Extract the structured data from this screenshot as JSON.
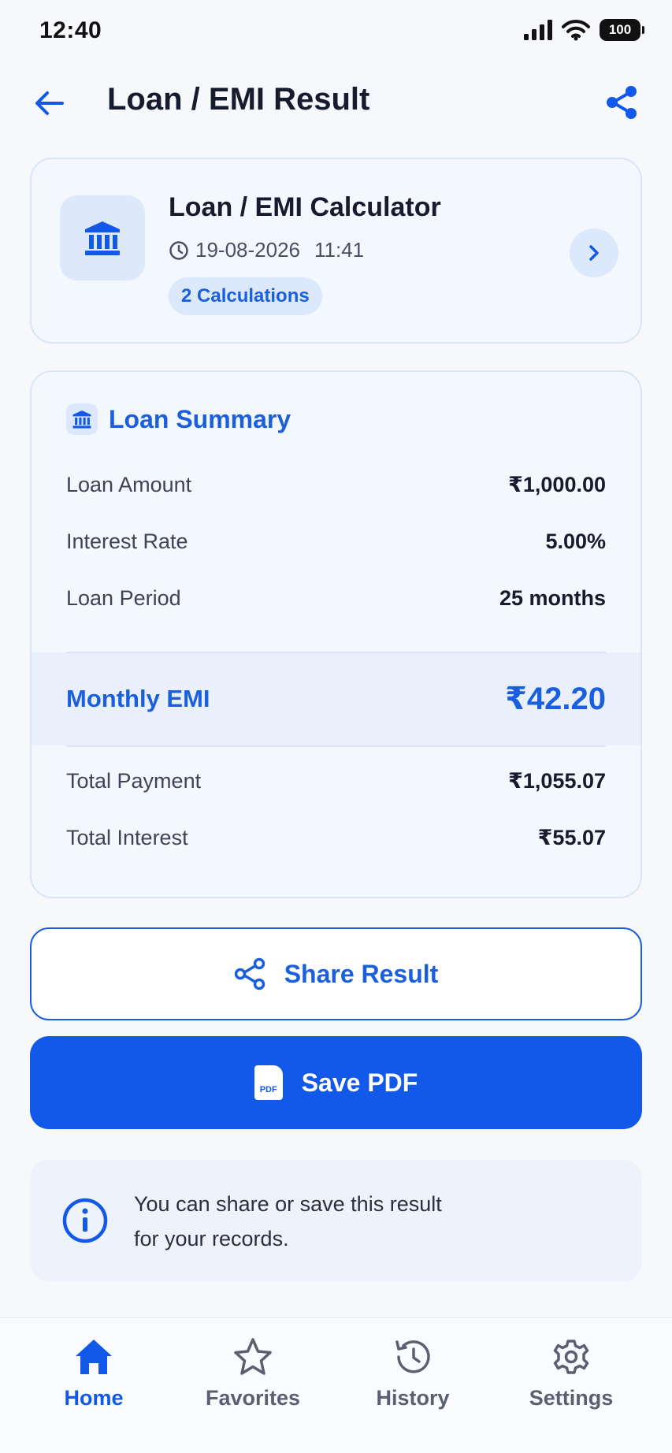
{
  "status_bar": {
    "time": "12:40",
    "battery": "100"
  },
  "header": {
    "title": "Loan / EMI Result"
  },
  "calc_card": {
    "title": "Loan / EMI Calculator",
    "date": "19-08-2026",
    "time": "11:41",
    "badge": "2 Calculations"
  },
  "summary": {
    "title": "Loan Summary",
    "rows": [
      {
        "label": "Loan Amount",
        "value": "₹1,000.00"
      },
      {
        "label": "Interest Rate",
        "value": "5.00%"
      },
      {
        "label": "Loan Period",
        "value": "25 months"
      }
    ],
    "emi": {
      "label": "Monthly EMI",
      "value": "₹42.20"
    },
    "totals": [
      {
        "label": "Total Payment",
        "value": "₹1,055.07"
      },
      {
        "label": "Total Interest",
        "value": "₹55.07"
      }
    ]
  },
  "actions": {
    "share_label": "Share Result",
    "pdf_label": "Save PDF",
    "pdf_badge": "PDF"
  },
  "info": {
    "line1": "You can share or save this result",
    "line2": "for your records."
  },
  "nav": {
    "items": [
      {
        "label": "Home",
        "icon": "home-icon",
        "active": true
      },
      {
        "label": "Favorites",
        "icon": "star-icon",
        "active": false
      },
      {
        "label": "History",
        "icon": "history-icon",
        "active": false
      },
      {
        "label": "Settings",
        "icon": "gear-icon",
        "active": false
      }
    ]
  },
  "colors": {
    "accent": "#1259ea",
    "accent_text": "#1a5fdd",
    "card_bg": "#f3f7fe",
    "text": "#161b2e"
  }
}
